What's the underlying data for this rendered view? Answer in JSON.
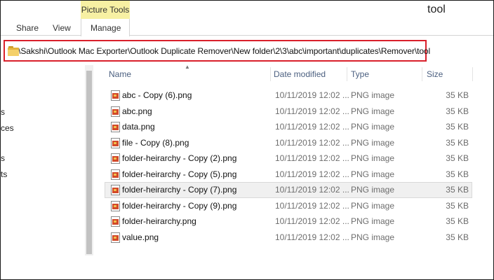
{
  "ribbon": {
    "contextual_header": "Picture Tools",
    "tabs": [
      {
        "label": "Share"
      },
      {
        "label": "View"
      },
      {
        "label": "Manage"
      }
    ]
  },
  "window": {
    "title": "tool"
  },
  "address_bar": {
    "path": "E:\\Sakshi\\Outlook Mac Exporter\\Outlook Duplicate Remover\\New folder\\2\\3\\abc\\important\\duplicates\\Remover\\tool",
    "highlight_color": "#d9202b"
  },
  "nav_pane": {
    "fragments": [
      "s",
      "ces",
      "s",
      "ts"
    ]
  },
  "columns": {
    "name": "Name",
    "date": "Date modified",
    "type": "Type",
    "size": "Size"
  },
  "files": [
    {
      "name": "abc - Copy (6).png",
      "date": "10/11/2019 12:02 ...",
      "type": "PNG image",
      "size": "35 KB"
    },
    {
      "name": "abc.png",
      "date": "10/11/2019 12:02 ...",
      "type": "PNG image",
      "size": "35 KB"
    },
    {
      "name": "data.png",
      "date": "10/11/2019 12:02 ...",
      "type": "PNG image",
      "size": "35 KB"
    },
    {
      "name": "file - Copy (8).png",
      "date": "10/11/2019 12:02 ...",
      "type": "PNG image",
      "size": "35 KB"
    },
    {
      "name": "folder-heirarchy - Copy (2).png",
      "date": "10/11/2019 12:02 ...",
      "type": "PNG image",
      "size": "35 KB"
    },
    {
      "name": "folder-heirarchy - Copy (5).png",
      "date": "10/11/2019 12:02 ...",
      "type": "PNG image",
      "size": "35 KB"
    },
    {
      "name": "folder-heirarchy - Copy (7).png",
      "date": "10/11/2019 12:02 ...",
      "type": "PNG image",
      "size": "35 KB",
      "hovered": true
    },
    {
      "name": "folder-heirarchy - Copy (9).png",
      "date": "10/11/2019 12:02 ...",
      "type": "PNG image",
      "size": "35 KB"
    },
    {
      "name": "folder-heirarchy.png",
      "date": "10/11/2019 12:02 ...",
      "type": "PNG image",
      "size": "35 KB"
    },
    {
      "name": "value.png",
      "date": "10/11/2019 12:02 ...",
      "type": "PNG image",
      "size": "35 KB"
    }
  ]
}
